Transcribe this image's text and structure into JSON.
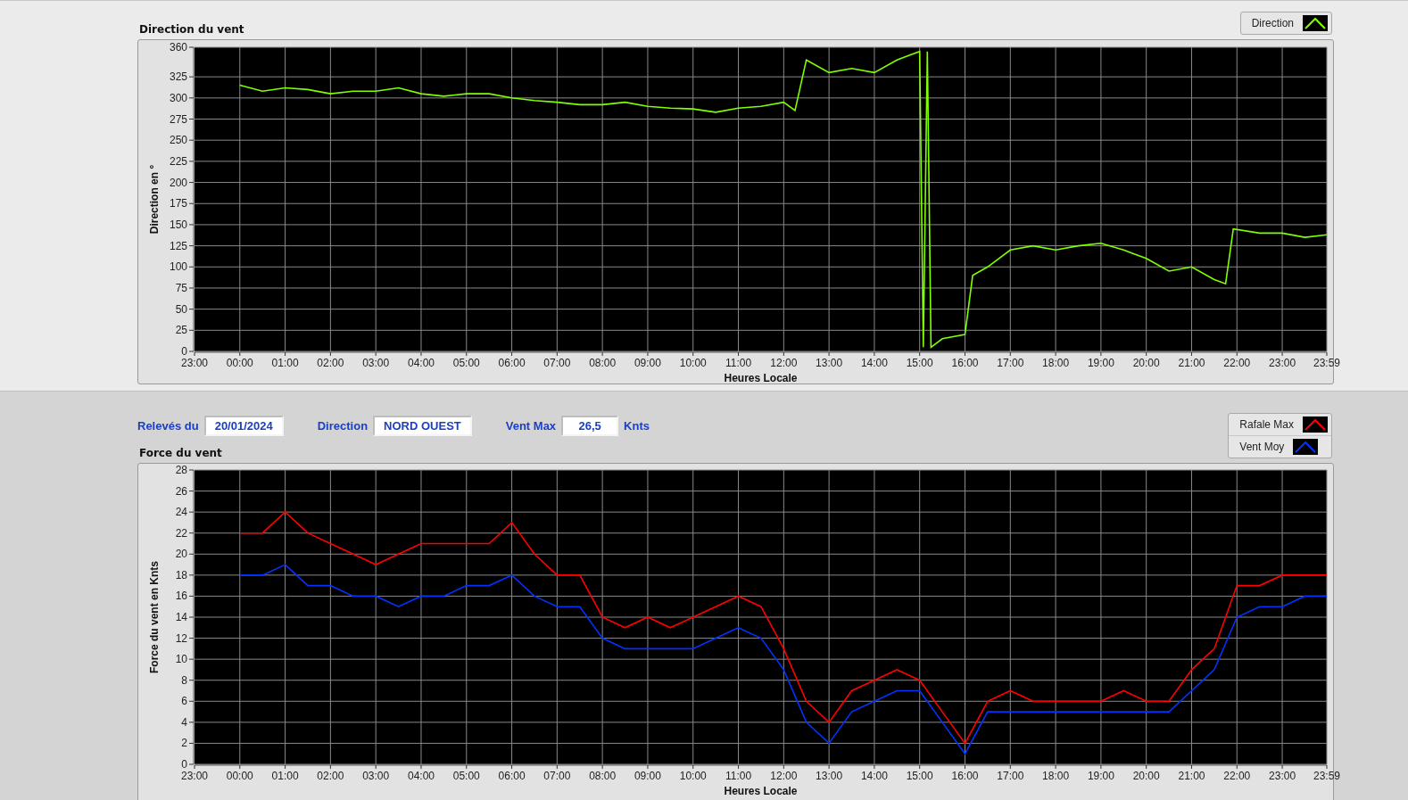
{
  "direction_chart": {
    "axis_start_label": "23:00",
    "chart_data": {
      "type": "line",
      "grid": true,
      "title": "Direction du vent",
      "xlabel": "Heures Locale",
      "ylabel": "Direction en °",
      "xlim": [
        -1,
        23.983
      ],
      "ylim": [
        0,
        360
      ],
      "yticks": [
        0,
        25,
        50,
        75,
        100,
        125,
        150,
        175,
        200,
        225,
        250,
        275,
        300,
        325,
        360
      ],
      "xticks": [
        {
          "value": 0,
          "label": "00:00"
        },
        {
          "value": 1,
          "label": "01:00"
        },
        {
          "value": 2,
          "label": "02:00"
        },
        {
          "value": 3,
          "label": "03:00"
        },
        {
          "value": 4,
          "label": "04:00"
        },
        {
          "value": 5,
          "label": "05:00"
        },
        {
          "value": 6,
          "label": "06:00"
        },
        {
          "value": 7,
          "label": "07:00"
        },
        {
          "value": 8,
          "label": "08:00"
        },
        {
          "value": 9,
          "label": "09:00"
        },
        {
          "value": 10,
          "label": "10:00"
        },
        {
          "value": 11,
          "label": "11:00"
        },
        {
          "value": 12,
          "label": "12:00"
        },
        {
          "value": 13,
          "label": "13:00"
        },
        {
          "value": 14,
          "label": "14:00"
        },
        {
          "value": 15,
          "label": "15:00"
        },
        {
          "value": 16,
          "label": "16:00"
        },
        {
          "value": 17,
          "label": "17:00"
        },
        {
          "value": 18,
          "label": "18:00"
        },
        {
          "value": 19,
          "label": "19:00"
        },
        {
          "value": 20,
          "label": "20:00"
        },
        {
          "value": 21,
          "label": "21:00"
        },
        {
          "value": 22,
          "label": "22:00"
        },
        {
          "value": 23,
          "label": "23:00"
        },
        {
          "value": 23.983,
          "label": "23:59"
        }
      ],
      "x": [
        0,
        0.5,
        1,
        1.5,
        2,
        2.5,
        3,
        3.5,
        4,
        4.5,
        5,
        5.5,
        6,
        6.5,
        7,
        7.5,
        8,
        8.5,
        9,
        9.5,
        10,
        10.5,
        11,
        11.5,
        12,
        12.25,
        12.5,
        13,
        13.5,
        14,
        14.5,
        15,
        15.08,
        15.17,
        15.25,
        15.5,
        16,
        16.17,
        16.5,
        17,
        17.5,
        18,
        18.5,
        19,
        19.5,
        20,
        20.5,
        21,
        21.5,
        21.75,
        21.92,
        22.5,
        23,
        23.5,
        23.983
      ],
      "series": [
        {
          "name": "Direction",
          "color": "#80ff00",
          "values": [
            315,
            308,
            312,
            310,
            305,
            308,
            308,
            312,
            305,
            302,
            305,
            305,
            300,
            297,
            295,
            292,
            292,
            295,
            290,
            288,
            287,
            283,
            288,
            290,
            295,
            285,
            345,
            330,
            335,
            330,
            345,
            355,
            5,
            355,
            5,
            15,
            20,
            90,
            100,
            120,
            125,
            120,
            125,
            128,
            120,
            110,
            95,
            100,
            85,
            80,
            145,
            140,
            140,
            135,
            138
          ]
        }
      ]
    }
  },
  "readings": [
    {
      "label": "Relevés du",
      "value": "20/01/2024"
    },
    {
      "label": "Direction",
      "value": "NORD OUEST"
    },
    {
      "label": "Vent Max",
      "value": "26,5",
      "unit": "Knts"
    }
  ],
  "force_chart": {
    "axis_start_label": "23:00",
    "chart_data": {
      "type": "line",
      "grid": true,
      "title": "Force du vent",
      "xlabel": "Heures Locale",
      "ylabel": "Force du vent en Knts",
      "xlim": [
        -1,
        23.983
      ],
      "ylim": [
        0,
        28
      ],
      "yticks": [
        0,
        2,
        4,
        6,
        8,
        10,
        12,
        14,
        16,
        18,
        20,
        22,
        24,
        26,
        28
      ],
      "xticks": [
        {
          "value": 0,
          "label": "00:00"
        },
        {
          "value": 1,
          "label": "01:00"
        },
        {
          "value": 2,
          "label": "02:00"
        },
        {
          "value": 3,
          "label": "03:00"
        },
        {
          "value": 4,
          "label": "04:00"
        },
        {
          "value": 5,
          "label": "05:00"
        },
        {
          "value": 6,
          "label": "06:00"
        },
        {
          "value": 7,
          "label": "07:00"
        },
        {
          "value": 8,
          "label": "08:00"
        },
        {
          "value": 9,
          "label": "09:00"
        },
        {
          "value": 10,
          "label": "10:00"
        },
        {
          "value": 11,
          "label": "11:00"
        },
        {
          "value": 12,
          "label": "12:00"
        },
        {
          "value": 13,
          "label": "13:00"
        },
        {
          "value": 14,
          "label": "14:00"
        },
        {
          "value": 15,
          "label": "15:00"
        },
        {
          "value": 16,
          "label": "16:00"
        },
        {
          "value": 17,
          "label": "17:00"
        },
        {
          "value": 18,
          "label": "18:00"
        },
        {
          "value": 19,
          "label": "19:00"
        },
        {
          "value": 20,
          "label": "20:00"
        },
        {
          "value": 21,
          "label": "21:00"
        },
        {
          "value": 22,
          "label": "22:00"
        },
        {
          "value": 23,
          "label": "23:00"
        },
        {
          "value": 23.983,
          "label": "23:59"
        }
      ],
      "x": [
        0,
        0.5,
        1,
        1.5,
        2,
        2.5,
        3,
        3.5,
        4,
        4.5,
        5,
        5.5,
        6,
        6.5,
        7,
        7.5,
        8,
        8.5,
        9,
        9.5,
        10,
        10.5,
        11,
        11.5,
        12,
        12.5,
        13,
        13.5,
        14,
        14.5,
        15,
        15.5,
        16,
        16.5,
        17,
        17.5,
        18,
        18.5,
        19,
        19.5,
        20,
        20.5,
        21,
        21.5,
        22,
        22.5,
        23,
        23.5,
        23.983
      ],
      "series": [
        {
          "name": "Rafale Max",
          "color": "#ff0000",
          "values": [
            22,
            22,
            24,
            22,
            21,
            20,
            19,
            20,
            21,
            21,
            21,
            21,
            23,
            20,
            18,
            18,
            14,
            13,
            14,
            13,
            14,
            15,
            16,
            15,
            11,
            6,
            4,
            7,
            8,
            9,
            8,
            5,
            2,
            6,
            7,
            6,
            6,
            6,
            6,
            7,
            6,
            6,
            9,
            11,
            17,
            17,
            18,
            18,
            18
          ]
        },
        {
          "name": "Vent Moy",
          "color": "#0033ff",
          "values": [
            18,
            18,
            19,
            17,
            17,
            16,
            16,
            15,
            16,
            16,
            17,
            17,
            18,
            16,
            15,
            15,
            12,
            11,
            11,
            11,
            11,
            12,
            13,
            12,
            9,
            4,
            2,
            5,
            6,
            7,
            7,
            4,
            1,
            5,
            5,
            5,
            5,
            5,
            5,
            5,
            5,
            5,
            7,
            9,
            14,
            15,
            15,
            16,
            16
          ]
        }
      ]
    }
  }
}
